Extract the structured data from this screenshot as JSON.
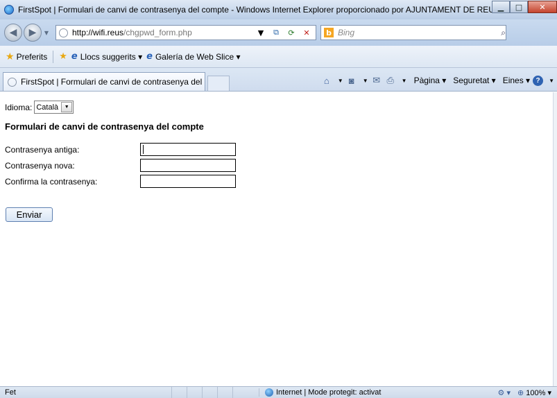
{
  "window": {
    "title": "FirstSpot | Formulari de canvi de contrasenya del compte - Windows Internet Explorer proporcionado por AJUNTAMENT DE REUS (p..."
  },
  "address": {
    "url_host": "http://wifi.reus",
    "url_path": "/chgpwd_form.php",
    "search_placeholder": "Bing"
  },
  "favorites": {
    "label": "Preferits",
    "links": [
      {
        "label": "Llocs suggerits ▾"
      },
      {
        "label": "Galería de Web Slice ▾"
      }
    ]
  },
  "tab": {
    "label": "FirstSpot | Formulari de canvi de contrasenya del ..."
  },
  "commands": {
    "page": "Pàgina ▾",
    "safety": "Seguretat ▾",
    "tools": "Eines ▾"
  },
  "page": {
    "language_label": "Idioma:",
    "language_value": "Català",
    "form_title": "Formulari de canvi de contrasenya del compte",
    "fields": [
      {
        "label": "Contrasenya antiga:",
        "value": ""
      },
      {
        "label": "Contrasenya nova:",
        "value": ""
      },
      {
        "label": "Confirma la contrasenya:",
        "value": ""
      }
    ],
    "submit_label": "Enviar"
  },
  "status": {
    "text": "Fet",
    "zone": "Internet | Mode protegit: activat",
    "zoom": "100%"
  }
}
